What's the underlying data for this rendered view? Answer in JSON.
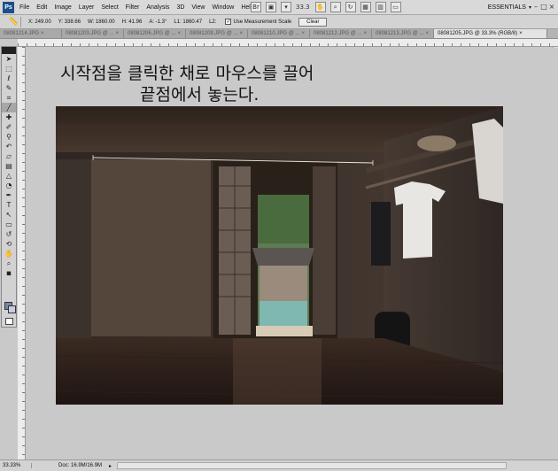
{
  "app": {
    "logo": "Ps"
  },
  "menu": [
    "File",
    "Edit",
    "Image",
    "Layer",
    "Select",
    "Filter",
    "Analysis",
    "3D",
    "View",
    "Window",
    "Help"
  ],
  "appbar": {
    "zoom": "33.3",
    "workspace": "ESSENTIALS"
  },
  "options": {
    "x": "X: 249.00",
    "y": "Y: 338.66",
    "w": "W: 1860.00",
    "h": "H: 41.96",
    "a": "A: -1.3°",
    "l1": "L1: 1860.47",
    "l2": "L2:",
    "use_scale": "Use Measurement Scale",
    "clear": "Clear"
  },
  "tabs": [
    {
      "label": "08081214.JPG",
      "active": false
    },
    {
      "label": "08081203.JPG @ ...",
      "active": false
    },
    {
      "label": "08081206.JPG @ ...",
      "active": false
    },
    {
      "label": "08081209.JPG @ ...",
      "active": false
    },
    {
      "label": "08081210.JPG @ ...",
      "active": false
    },
    {
      "label": "08081212.JPG @ ...",
      "active": false
    },
    {
      "label": "08081213.JPG @ ...",
      "active": false
    },
    {
      "label": "08081205.JPG @ 33.3% (RGB/8)",
      "active": true
    }
  ],
  "caption": {
    "line1": "시작점을 클릭한 채로 마우스를 끌어",
    "line2": "끝점에서 놓는다."
  },
  "status": {
    "zoom": "33.33%",
    "doc": "Doc: 16.9M/16.9M"
  },
  "colors": {
    "foreground": "#7788a8",
    "background": "#c7cde0"
  }
}
